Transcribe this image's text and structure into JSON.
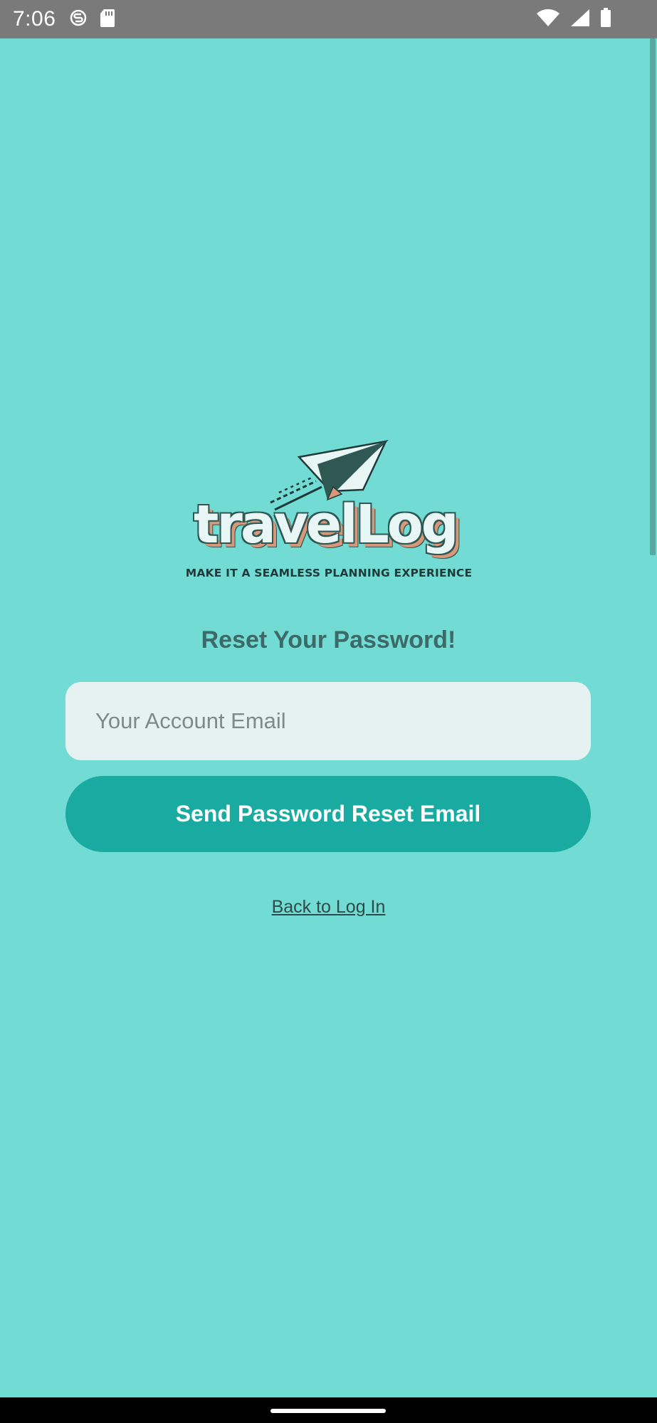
{
  "status_bar": {
    "time": "7:06",
    "icons_left": [
      "s-circle-icon",
      "sd-card-icon"
    ],
    "icons_right": [
      "wifi-icon",
      "cell-signal-icon",
      "battery-icon"
    ]
  },
  "logo": {
    "wordmark": "travelLog",
    "tagline": "MAKE IT A SEAMLESS PLANNING EXPERIENCE"
  },
  "title": "Reset Your Password!",
  "email_field": {
    "placeholder": "Your Account Email",
    "value": ""
  },
  "send_button_label": "Send Password Reset Email",
  "back_link_label": "Back to Log In",
  "colors": {
    "background": "#72dbd4",
    "button": "#19aaa1",
    "input": "#e6f2f1",
    "title": "#3d6a67"
  }
}
